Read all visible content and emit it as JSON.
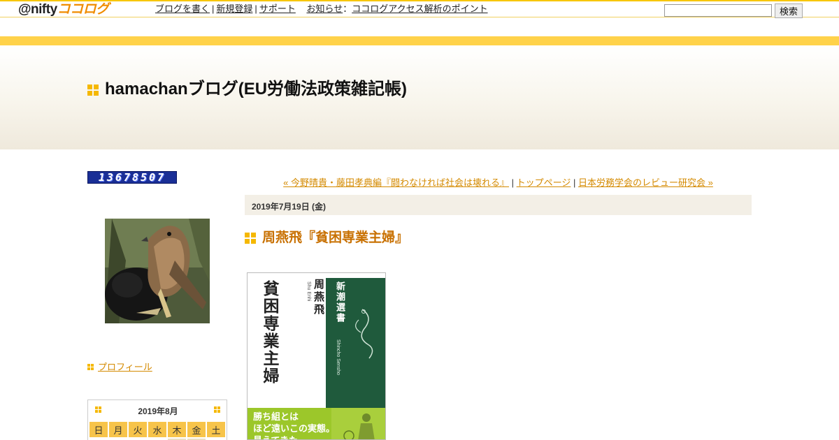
{
  "topbar": {
    "logo_prefix": "@nifty",
    "logo_suffix": "ココログ",
    "nav": {
      "write": "ブログを書く",
      "register": "新規登録",
      "support": "サポート",
      "news_label": "お知らせ",
      "news_sep": "：",
      "news_link": "ココログアクセス解析のポイント"
    },
    "search": {
      "placeholder": "",
      "button": "検索"
    }
  },
  "header": {
    "title": "hamachanブログ(EU労働法政策雑記帳)"
  },
  "sidebar": {
    "counter": "13678507",
    "profile_link": "プロフィール",
    "calendar": {
      "title": "2019年8月",
      "days": [
        "日",
        "月",
        "火",
        "水",
        "木",
        "金",
        "土"
      ]
    }
  },
  "main": {
    "nav": {
      "prev": "« 今野晴貴・藤田孝典編『闘わなければ社会は壊れる』",
      "sep1": " | ",
      "top": "トップページ",
      "sep2": " | ",
      "next": "日本労務学会のレビュー研究会 »"
    },
    "date": "2019年7月19日 (金)",
    "entry_title": "周燕飛『貧困専業主婦』",
    "book": {
      "title": "貧困専業主婦",
      "author": "周燕飛",
      "author_roman": "Shu Enhi",
      "series": "新潮選書",
      "series_roman": "Shincho Sensho",
      "band_line1": "勝ち組とは",
      "band_line2": "ほど遠いこの実態。",
      "band_line3": "見えてきた"
    }
  },
  "colors": {
    "accent": "#f5b800",
    "link": "#d48a00",
    "entry_title": "#c87000",
    "stripe": "#ffd24a",
    "book_green": "#1f5a3c",
    "book_band": "#9cc72a"
  }
}
